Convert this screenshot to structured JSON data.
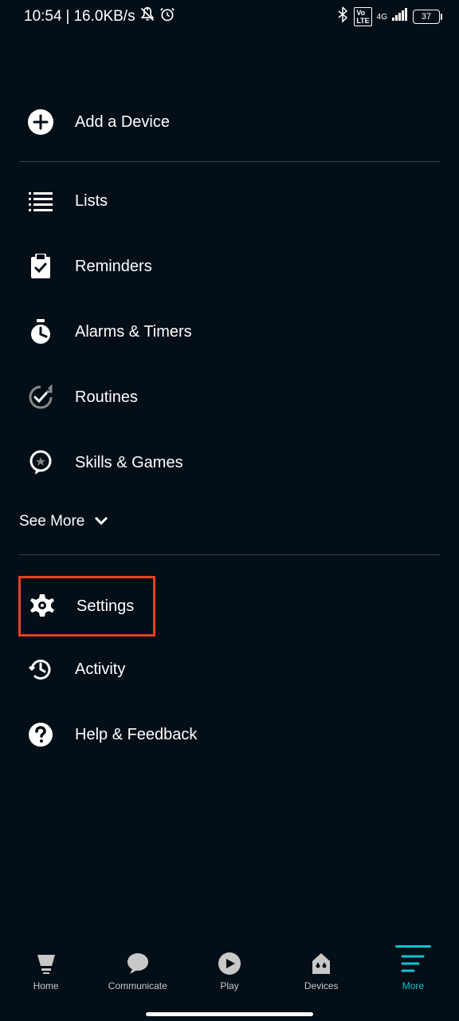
{
  "status": {
    "time": "10:54",
    "speed": "16.0KB/s",
    "battery": "37"
  },
  "menu": {
    "addDevice": "Add a Device",
    "lists": "Lists",
    "reminders": "Reminders",
    "alarms": "Alarms & Timers",
    "routines": "Routines",
    "skills": "Skills & Games",
    "seeMore": "See More",
    "settings": "Settings",
    "activity": "Activity",
    "help": "Help & Feedback"
  },
  "nav": {
    "home": "Home",
    "communicate": "Communicate",
    "play": "Play",
    "devices": "Devices",
    "more": "More"
  }
}
